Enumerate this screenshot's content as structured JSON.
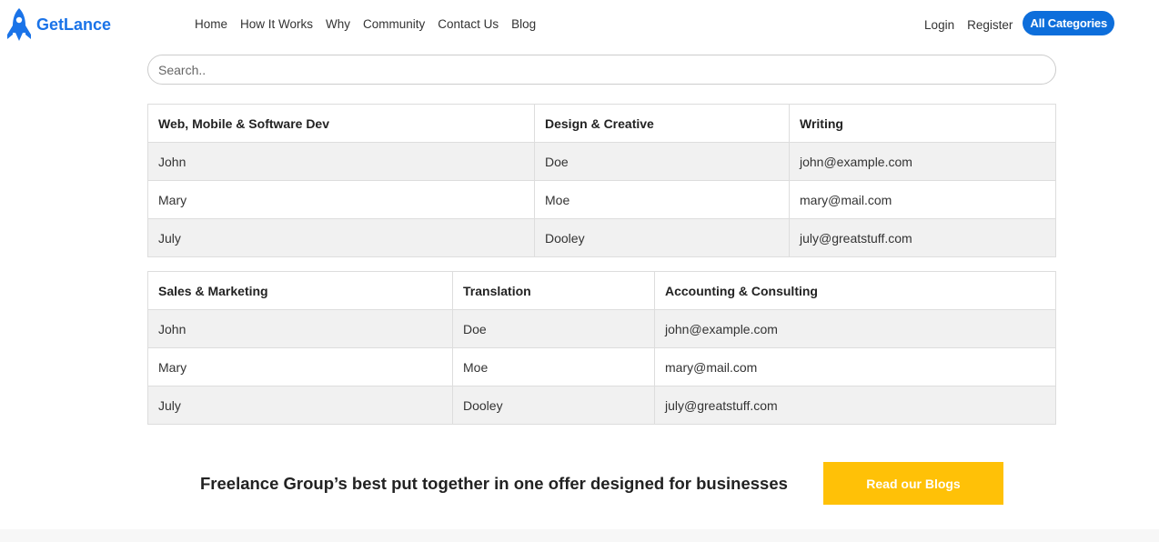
{
  "brand": {
    "name": "GetLance",
    "logo_icon": "rocket-icon",
    "color": "#1a73e8"
  },
  "nav": {
    "links": [
      "Home",
      "How It Works",
      "Why",
      "Community",
      "Contact Us",
      "Blog"
    ],
    "login": "Login",
    "register": "Register",
    "categories_button": "All Categories"
  },
  "search": {
    "placeholder": "Search.."
  },
  "tables": [
    {
      "headers": [
        "Web, Mobile & Software Dev",
        "Design & Creative",
        "Writing"
      ],
      "rows": [
        [
          "John",
          "Doe",
          "john@example.com"
        ],
        [
          "Mary",
          "Moe",
          "mary@mail.com"
        ],
        [
          "July",
          "Dooley",
          "july@greatstuff.com"
        ]
      ]
    },
    {
      "headers": [
        "Sales & Marketing",
        "Translation",
        "Accounting & Consulting"
      ],
      "rows": [
        [
          "John",
          "Doe",
          "john@example.com"
        ],
        [
          "Mary",
          "Moe",
          "mary@mail.com"
        ],
        [
          "July",
          "Dooley",
          "july@greatstuff.com"
        ]
      ]
    }
  ],
  "promo": {
    "text": "Freelance Group’s best put together in one offer designed for businesses",
    "button": "Read our Blogs",
    "button_color": "#ffc107"
  },
  "colors": {
    "accent": "#0d6edb",
    "row_stripe": "#f1f1f1"
  }
}
